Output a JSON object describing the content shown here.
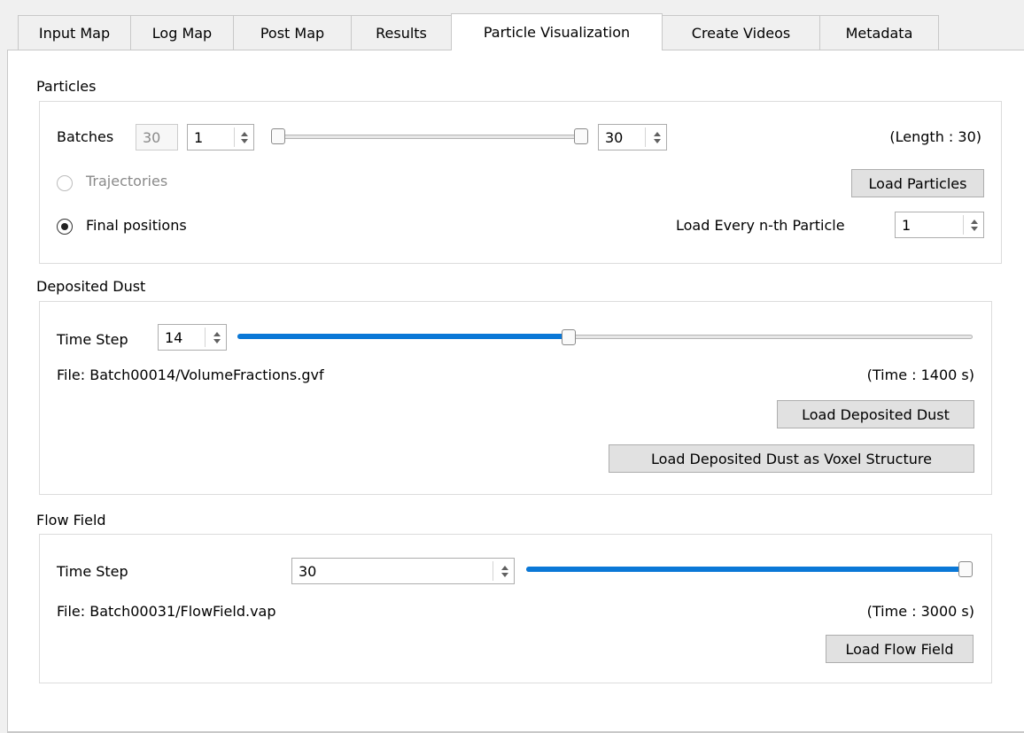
{
  "tabs": [
    {
      "label": "Input Map",
      "active": false
    },
    {
      "label": "Log Map",
      "active": false
    },
    {
      "label": "Post Map",
      "active": false
    },
    {
      "label": "Results",
      "active": false
    },
    {
      "label": "Particle Visualization",
      "active": true
    },
    {
      "label": "Create Videos",
      "active": false
    },
    {
      "label": "Metadata",
      "active": false
    }
  ],
  "particles": {
    "title": "Particles",
    "batches_label": "Batches",
    "batch_count": "30",
    "batch_from": "1",
    "batch_to": "30",
    "length_text": "(Length : 30)",
    "trajectories_label": "Trajectories",
    "final_positions_label": "Final positions",
    "selected_mode": "Final positions",
    "load_particles_label": "Load Particles",
    "every_nth_label": "Load Every n-th Particle",
    "every_nth_value": "1"
  },
  "deposited_dust": {
    "title": "Deposited Dust",
    "time_step_label": "Time Step",
    "time_step_value": "14",
    "slider_fraction": 0.45,
    "file_text": "File: Batch00014/VolumeFractions.gvf",
    "time_text": "(Time : 1400 s)",
    "load_label": "Load Deposited Dust",
    "load_voxel_label": "Load Deposited Dust as Voxel Structure"
  },
  "flow_field": {
    "title": "Flow Field",
    "time_step_label": "Time Step",
    "time_step_value": "30",
    "slider_fraction": 1.0,
    "file_text": "File: Batch00031/FlowField.vap",
    "time_text": "(Time : 3000 s)",
    "load_label": "Load Flow Field"
  },
  "colors": {
    "accent": "#0a78d7",
    "panel_bg": "#ffffff",
    "window_bg": "#f0f0f0"
  }
}
